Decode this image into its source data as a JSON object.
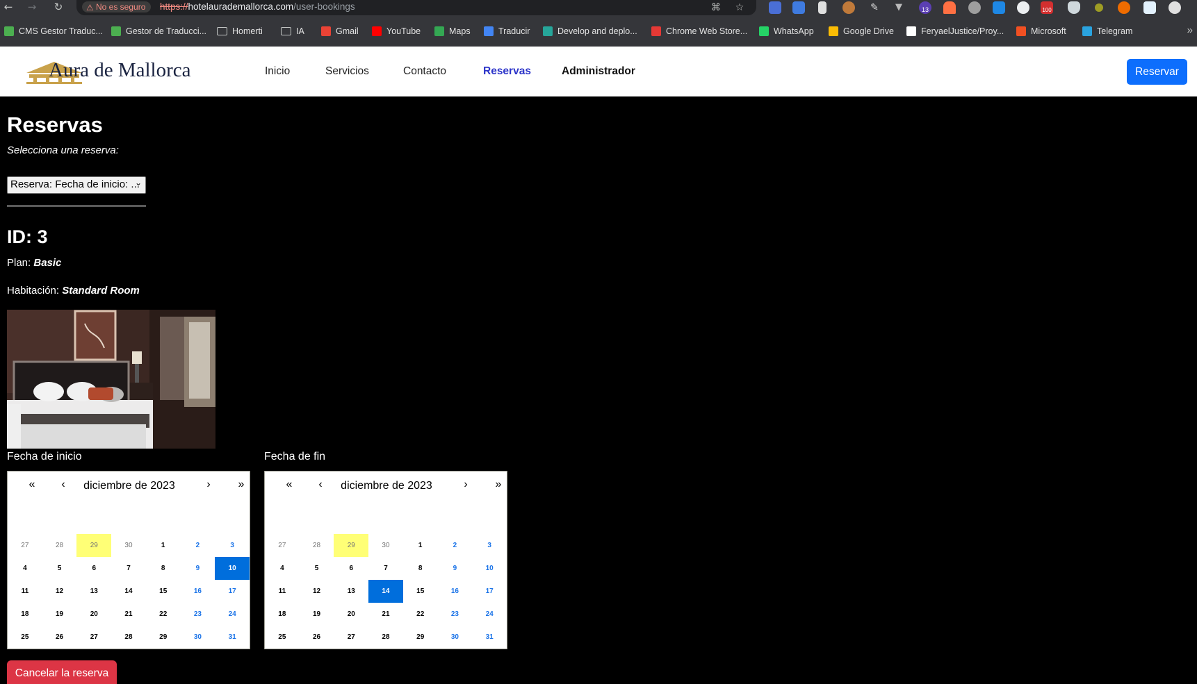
{
  "browser": {
    "security_label": "No es seguro",
    "url_scheme": "https://",
    "url_host": "hotelaurademallorca.com",
    "url_path": "/user-bookings",
    "extension_badge_count": "13",
    "extension_badge_count2": "100",
    "bookmarks": [
      {
        "label": "CMS Gestor Traduc...",
        "icon_color": "#4caf50"
      },
      {
        "label": "Gestor de Traducci...",
        "icon_color": "#4caf50"
      },
      {
        "label": "Homerti",
        "icon": "folder"
      },
      {
        "label": "IA",
        "icon": "folder"
      },
      {
        "label": "Gmail",
        "icon_color": "#ea4335"
      },
      {
        "label": "YouTube",
        "icon_color": "#ff0000"
      },
      {
        "label": "Maps",
        "icon_color": "#34a853"
      },
      {
        "label": "Traducir",
        "icon_color": "#4285f4"
      },
      {
        "label": "Develop and deplo...",
        "icon_color": "#26a69a"
      },
      {
        "label": "Chrome Web Store...",
        "icon_color": "#e53935"
      },
      {
        "label": "WhatsApp",
        "icon_color": "#25d366"
      },
      {
        "label": "Google Drive",
        "icon_color": "#fbbc04"
      },
      {
        "label": "FeryaelJustice/Proy...",
        "icon_color": "#ffffff"
      },
      {
        "label": "Microsoft",
        "icon_color": "#f25022"
      },
      {
        "label": "Telegram",
        "icon_color": "#2aa3df"
      }
    ],
    "more_bookmarks": "»"
  },
  "site": {
    "logo_text": "Aura de Mallorca",
    "nav": {
      "inicio": "Inicio",
      "servicios": "Servicios",
      "contacto": "Contacto",
      "reservas": "Reservas",
      "administrador": "Administrador"
    },
    "reserve_button": "Reservar",
    "accent_color": "#0d6efd",
    "active_nav_color": "#2c34c9"
  },
  "main": {
    "title": "Reservas",
    "select_prompt": "Selecciona una reserva:",
    "select_value": "Reserva: Fecha de inicio: ...",
    "id_label": "ID: 3",
    "plan_label": "Plan:",
    "plan_value": "Basic",
    "room_label": "Habitación:",
    "room_value": "Standard Room",
    "start_label": "Fecha de inicio",
    "end_label": "Fecha de fin",
    "cancel_button": "Cancelar la reserva"
  },
  "calendars": [
    {
      "month": "diciembre de 2023",
      "selected_day": "10",
      "nav": {
        "prev_year": "«",
        "prev": "‹",
        "next": "›",
        "next_year": "»"
      }
    },
    {
      "month": "diciembre de 2023",
      "selected_day": "14",
      "nav": {
        "prev_year": "«",
        "prev": "‹",
        "next": "›",
        "next_year": "»"
      }
    }
  ],
  "calendar_days": [
    {
      "d": "27",
      "t": "neighbor"
    },
    {
      "d": "28",
      "t": "neighbor"
    },
    {
      "d": "29",
      "t": "today"
    },
    {
      "d": "30",
      "t": "neighbor"
    },
    {
      "d": "1",
      "t": ""
    },
    {
      "d": "2",
      "t": "weekend"
    },
    {
      "d": "3",
      "t": "weekend"
    },
    {
      "d": "4",
      "t": ""
    },
    {
      "d": "5",
      "t": ""
    },
    {
      "d": "6",
      "t": ""
    },
    {
      "d": "7",
      "t": ""
    },
    {
      "d": "8",
      "t": ""
    },
    {
      "d": "9",
      "t": "weekend"
    },
    {
      "d": "10",
      "t": "weekend"
    },
    {
      "d": "11",
      "t": ""
    },
    {
      "d": "12",
      "t": ""
    },
    {
      "d": "13",
      "t": ""
    },
    {
      "d": "14",
      "t": ""
    },
    {
      "d": "15",
      "t": ""
    },
    {
      "d": "16",
      "t": "weekend"
    },
    {
      "d": "17",
      "t": "weekend"
    },
    {
      "d": "18",
      "t": ""
    },
    {
      "d": "19",
      "t": ""
    },
    {
      "d": "20",
      "t": ""
    },
    {
      "d": "21",
      "t": ""
    },
    {
      "d": "22",
      "t": ""
    },
    {
      "d": "23",
      "t": "weekend"
    },
    {
      "d": "24",
      "t": "weekend"
    },
    {
      "d": "25",
      "t": ""
    },
    {
      "d": "26",
      "t": ""
    },
    {
      "d": "27",
      "t": ""
    },
    {
      "d": "28",
      "t": ""
    },
    {
      "d": "29",
      "t": ""
    },
    {
      "d": "30",
      "t": "weekend"
    },
    {
      "d": "31",
      "t": "weekend"
    }
  ]
}
